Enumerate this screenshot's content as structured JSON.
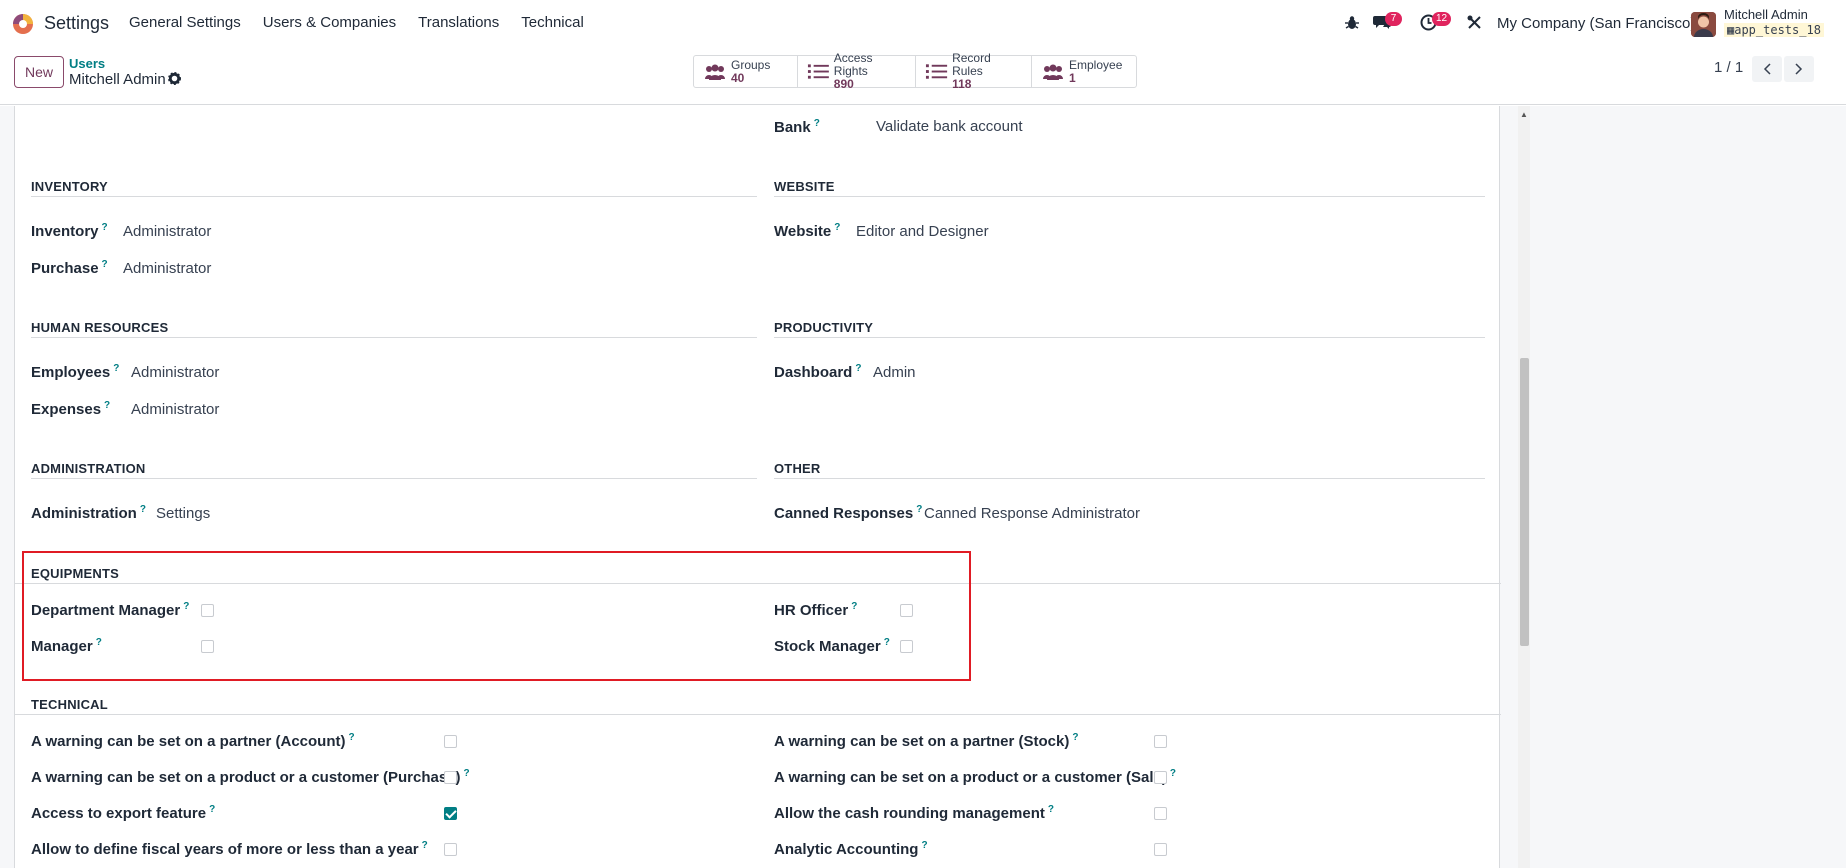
{
  "navbar": {
    "app_title": "Settings",
    "menu": [
      "General Settings",
      "Users & Companies",
      "Translations",
      "Technical"
    ],
    "chat_count": "7",
    "activity_count": "12",
    "company": "My Company (San Francisco)",
    "user_name": "Mitchell Admin",
    "db_name": "app_tests_18",
    "icons": [
      "bug-icon",
      "chat-icon",
      "clock-icon",
      "tools-icon"
    ]
  },
  "control": {
    "new_label": "New",
    "breadcrumb_parent": "Users",
    "breadcrumb_current": "Mitchell Admin",
    "pager": "1 / 1",
    "stats": [
      {
        "label": "Groups",
        "value": "40",
        "icon": "users-icon"
      },
      {
        "label": "Access Rights",
        "value": "890",
        "icon": "list-icon"
      },
      {
        "label": "Record Rules",
        "value": "118",
        "icon": "list-icon"
      },
      {
        "label": "Employee",
        "value": "1",
        "icon": "users-icon"
      }
    ]
  },
  "form": {
    "bank": {
      "label": "Bank",
      "value": "Validate bank account"
    },
    "inventory": {
      "title": "INVENTORY",
      "fields": [
        {
          "label": "Inventory",
          "value": "Administrator"
        },
        {
          "label": "Purchase",
          "value": "Administrator"
        }
      ]
    },
    "website": {
      "title": "WEBSITE",
      "fields": [
        {
          "label": "Website",
          "value": "Editor and Designer"
        }
      ]
    },
    "human_resources": {
      "title": "HUMAN RESOURCES",
      "fields": [
        {
          "label": "Employees",
          "value": "Administrator"
        },
        {
          "label": "Expenses",
          "value": "Administrator"
        }
      ]
    },
    "productivity": {
      "title": "PRODUCTIVITY",
      "fields": [
        {
          "label": "Dashboard",
          "value": "Admin"
        }
      ]
    },
    "administration": {
      "title": "ADMINISTRATION",
      "fields": [
        {
          "label": "Administration",
          "value": "Settings"
        }
      ]
    },
    "other": {
      "title": "OTHER",
      "fields": [
        {
          "label": "Canned Responses",
          "value": "Canned Response Administrator"
        }
      ]
    },
    "equipments": {
      "title": "EQUIPMENTS",
      "left": [
        {
          "label": "Department Manager",
          "checked": false
        },
        {
          "label": "Manager",
          "checked": false
        }
      ],
      "right": [
        {
          "label": "HR Officer",
          "checked": false
        },
        {
          "label": "Stock Manager",
          "checked": false
        }
      ]
    },
    "technical": {
      "title": "TECHNICAL",
      "left": [
        {
          "label": "A warning can be set on a partner (Account)",
          "checked": false
        },
        {
          "label": "A warning can be set on a product or a customer (Purchase)",
          "checked": false
        },
        {
          "label": "Access to export feature",
          "checked": true
        },
        {
          "label": "Allow to define fiscal years of more or less than a year",
          "checked": false
        }
      ],
      "right": [
        {
          "label": "A warning can be set on a partner (Stock)",
          "checked": false
        },
        {
          "label": "A warning can be set on a product or a customer (Sale)",
          "checked": false
        },
        {
          "label": "Allow the cash rounding management",
          "checked": false
        },
        {
          "label": "Analytic Accounting",
          "checked": false
        }
      ]
    },
    "help_mark": "?"
  },
  "colors": {
    "accent": "#71395b",
    "teal": "#017e84",
    "highlight": "#e01b24",
    "badge": "#e0245e"
  }
}
